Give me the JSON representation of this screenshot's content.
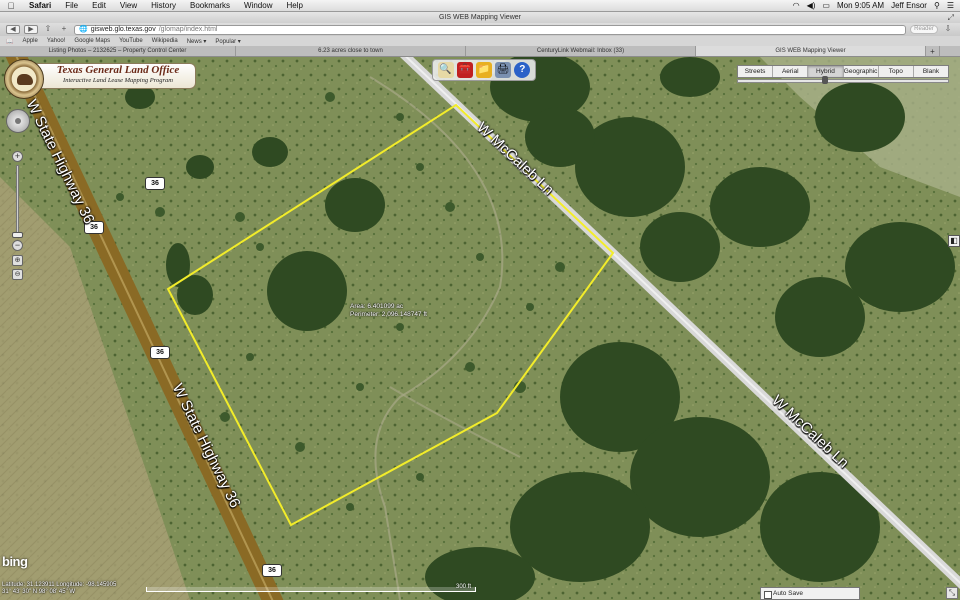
{
  "menubar": {
    "apple_icon": "apple-logo-icon",
    "items": [
      "Safari",
      "File",
      "Edit",
      "View",
      "History",
      "Bookmarks",
      "Window",
      "Help"
    ],
    "clock": "Mon 9:05 AM",
    "user": "Jeff Ensor"
  },
  "window": {
    "title": "GIS WEB Mapping Viewer"
  },
  "toolbar": {
    "url_host": "gisweb.glo.texas.gov",
    "url_path": "/glomap/index.html",
    "reader_label": "Reader"
  },
  "bookmarks": [
    "Apple",
    "Yahoo!",
    "Google Maps",
    "YouTube",
    "Wikipedia",
    "News ▾",
    "Popular ▾"
  ],
  "tabs": [
    {
      "label": "Listing Photos – 2132625 – Property Control Center"
    },
    {
      "label": "6.23 acres close to town"
    },
    {
      "label": "CenturyLink Webmail: Inbox (33)"
    },
    {
      "label": "GIS WEB Mapping Viewer",
      "active": true
    }
  ],
  "logo": {
    "title": "Texas General Land Office",
    "subtitle": "Interactive Land Lease Mapping Program"
  },
  "tools": [
    "identify-tool-icon",
    "toolbox-icon",
    "folder-icon",
    "printer-icon",
    "help-icon"
  ],
  "tools_glyphs": [
    "🔍",
    "🧰",
    "📁",
    "🖨",
    "?"
  ],
  "map_types": [
    {
      "label": "Streets"
    },
    {
      "label": "Aerial"
    },
    {
      "label": "Hybrid",
      "active": true
    },
    {
      "label": "Geographic"
    },
    {
      "label": "Topo"
    },
    {
      "label": "Blank"
    }
  ],
  "roads": {
    "highway_label": "W State Highway 36",
    "mccaleb_label": "W McCaleb Ln",
    "shield": "36"
  },
  "measurement": {
    "area": "Area: 6.401099 ac",
    "perimeter": "Perimeter: 2,096.148747 ft"
  },
  "footer": {
    "bing": "bing",
    "latitude_line": "Latitude: 31.123911  Longitude: -98.145905",
    "dms_line": "31° 43' 30\" N        98° 08' 45\" W",
    "scale_label": "300 ft",
    "autosave_label": "Auto Save"
  },
  "colors": {
    "parcel_outline": "#f2ec2a",
    "highway": "#8a6a25",
    "road": "#d9d9d9",
    "terrain": "#7d8e56"
  }
}
